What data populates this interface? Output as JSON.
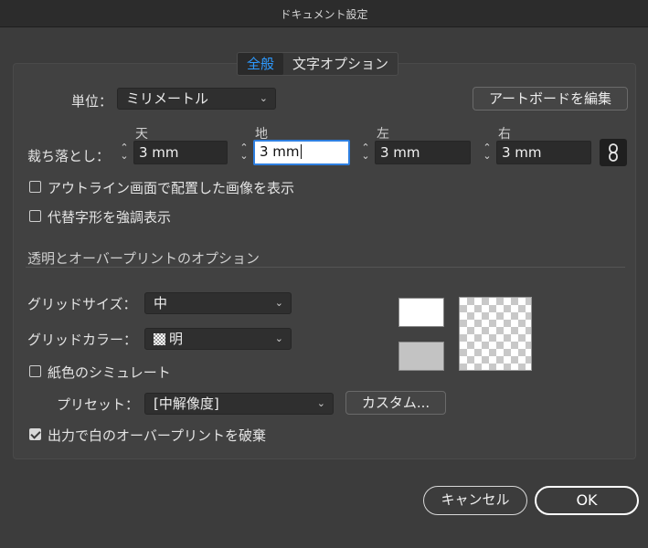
{
  "window": {
    "title": "ドキュメント設定"
  },
  "tabs": [
    {
      "label": "全般",
      "active": true
    },
    {
      "label": "文字オプション",
      "active": false
    }
  ],
  "units": {
    "label": "単位：",
    "value": "ミリメートル"
  },
  "artboard_button": "アートボードを編集",
  "bleed": {
    "label": "裁ち落とし：",
    "top_label": "天",
    "bottom_label": "地",
    "left_label": "左",
    "right_label": "右",
    "top": "3 mm",
    "bottom": "3 mm",
    "left": "3 mm",
    "right": "3 mm",
    "link_icon": "chain-link-icon"
  },
  "options": {
    "outline_placed": "アウトライン画面で配置した画像を表示",
    "substitute_glyphs": "代替字形を強調表示"
  },
  "transparency": {
    "section_title": "透明とオーバープリントのオプション",
    "grid_size_label": "グリッドサイズ：",
    "grid_size_value": "中",
    "grid_color_label": "グリッドカラー：",
    "grid_color_value": "明",
    "simulate_paper": "紙色のシミュレート",
    "preset_label": "プリセット：",
    "preset_value": "[中解像度]",
    "custom_button": "カスタム...",
    "discard_white_overprint": "出力で白のオーバープリントを破棄",
    "discard_checked": true
  },
  "footer": {
    "cancel": "キャンセル",
    "ok": "OK"
  },
  "colors": {
    "accent": "#2d9aff",
    "background": "#3c3c3c",
    "field": "#2b2b2b"
  }
}
